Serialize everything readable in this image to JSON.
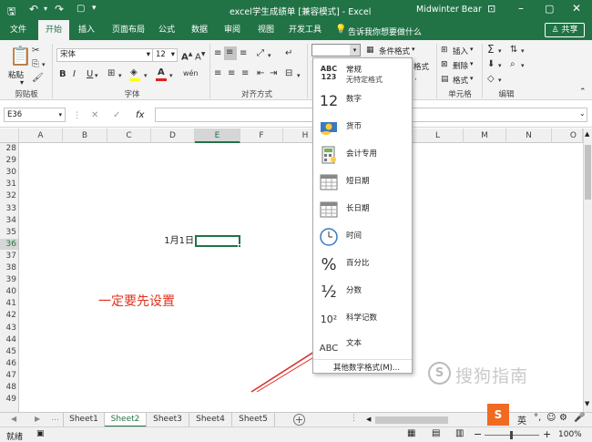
{
  "window": {
    "title": "excel学生成绩单 [兼容模式] - Excel",
    "user": "Midwinter Bear"
  },
  "tabs": [
    "文件",
    "开始",
    "插入",
    "页面布局",
    "公式",
    "数据",
    "审阅",
    "视图",
    "开发工具"
  ],
  "tellme": "告诉我你想要做什么",
  "share": "共享",
  "ribbon": {
    "paste_label": "粘贴",
    "font_name": "宋体",
    "font_size": "12",
    "cond_format": "条件格式",
    "insert": "插入",
    "delete": "删除",
    "format": "格式",
    "insert_suffix": "格式",
    "groups": {
      "clipboard": "剪贴板",
      "font": "字体",
      "align": "对齐方式",
      "cells": "单元格",
      "edit": "编辑"
    }
  },
  "formula": {
    "name_box": "E36",
    "fx": "fx"
  },
  "columns": [
    "A",
    "B",
    "C",
    "D",
    "E",
    "F",
    "G",
    "H",
    "I",
    "J",
    "K",
    "L",
    "M",
    "N",
    "O"
  ],
  "rows": [
    "28",
    "29",
    "30",
    "31",
    "32",
    "33",
    "34",
    "35",
    "36",
    "37",
    "38",
    "39",
    "40",
    "41",
    "42",
    "43",
    "44",
    "45",
    "46",
    "47",
    "48",
    "49"
  ],
  "cells": {
    "d36": "1月1日",
    "note": "一定要先设置"
  },
  "number_format_menu": {
    "items": [
      {
        "icon": "ABC 123",
        "label": "常规",
        "sub": "无特定格式"
      },
      {
        "icon": "12",
        "label": "数字"
      },
      {
        "icon": "currency-icon",
        "label": "货币"
      },
      {
        "icon": "accounting-icon",
        "label": "会计专用"
      },
      {
        "icon": "calendar-icon",
        "label": "短日期"
      },
      {
        "icon": "calendar-icon",
        "label": "长日期"
      },
      {
        "icon": "clock-icon",
        "label": "时间"
      },
      {
        "icon": "%",
        "label": "百分比"
      },
      {
        "icon": "½",
        "label": "分数"
      },
      {
        "icon": "10²",
        "label": "科学记数"
      },
      {
        "icon": "ABC",
        "label": "文本"
      }
    ],
    "more": "其他数字格式(M)..."
  },
  "sheets": [
    "Sheet1",
    "Sheet2",
    "Sheet3",
    "Sheet4",
    "Sheet5"
  ],
  "active_sheet": "Sheet2",
  "status": {
    "ready": "就绪",
    "zoom": "100%"
  },
  "watermark": "搜狗指南",
  "colors": {
    "excel_green": "#217346",
    "note_red": "#e0321e",
    "arrow_red": "#d9302b"
  }
}
